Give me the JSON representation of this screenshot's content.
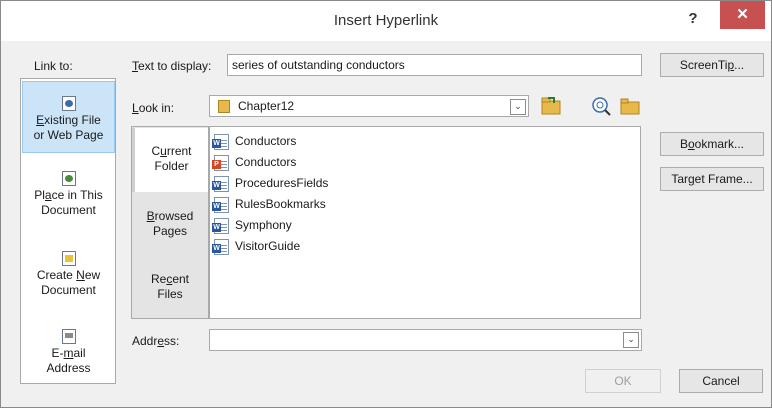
{
  "window": {
    "title": "Insert Hyperlink",
    "help_glyph": "?",
    "close_glyph": "✕"
  },
  "link_to": {
    "label": "Link to:",
    "items": [
      {
        "line1_pre": "",
        "line1_u": "E",
        "line1_post": "xisting File",
        "line2": "or Web Page",
        "icon": "web-page-icon",
        "selected": true
      },
      {
        "line1_pre": "Pl",
        "line1_u": "a",
        "line1_post": "ce in This",
        "line2": "Document",
        "icon": "place-in-document-icon",
        "selected": false
      },
      {
        "line1_pre": "Create ",
        "line1_u": "N",
        "line1_post": "ew",
        "line2": "Document",
        "icon": "new-document-icon",
        "selected": false
      },
      {
        "line1_pre": "E-",
        "line1_u": "m",
        "line1_post": "ail",
        "line2": "Address",
        "icon": "email-icon",
        "selected": false
      }
    ]
  },
  "text_to_display": {
    "label_u": "T",
    "label_rest": "ext to display:",
    "value": "series of outstanding conductors"
  },
  "look_in": {
    "label_u": "L",
    "label_rest": "ook in:",
    "value": "Chapter12",
    "arrow": "⌄"
  },
  "folder_tabs": [
    {
      "pre": "C",
      "u": "u",
      "post": "rrent",
      "line2": "Folder",
      "selected": true
    },
    {
      "pre": "",
      "u": "B",
      "post": "rowsed",
      "line2": "Pages",
      "selected": false
    },
    {
      "pre": "Re",
      "u": "c",
      "post": "ent",
      "line2": "Files",
      "selected": false
    }
  ],
  "files": [
    {
      "name": "Conductors",
      "type": "word"
    },
    {
      "name": "Conductors",
      "type": "ppt"
    },
    {
      "name": "ProceduresFields",
      "type": "word"
    },
    {
      "name": "RulesBookmarks",
      "type": "word"
    },
    {
      "name": "Symphony",
      "type": "word"
    },
    {
      "name": "VisitorGuide",
      "type": "word"
    }
  ],
  "file_badges": {
    "word": "W",
    "ppt": "P"
  },
  "buttons": {
    "screentip_pre": "ScreenTi",
    "screentip_u": "p",
    "screentip_post": "...",
    "bookmark_pre": "B",
    "bookmark_u": "o",
    "bookmark_post": "okmark...",
    "target_pre": "Tar",
    "target_u": "g",
    "target_post": "et Frame...",
    "ok": "OK",
    "cancel": "Cancel"
  },
  "address": {
    "label_pre": "Addr",
    "label_u": "e",
    "label_post": "ss:",
    "value": "",
    "arrow": "⌄"
  },
  "colors": {
    "selection": "#cce4f7",
    "close_bg": "#c75050",
    "word": "#2b579a",
    "ppt": "#d24726",
    "folder": "#e8b84a"
  }
}
